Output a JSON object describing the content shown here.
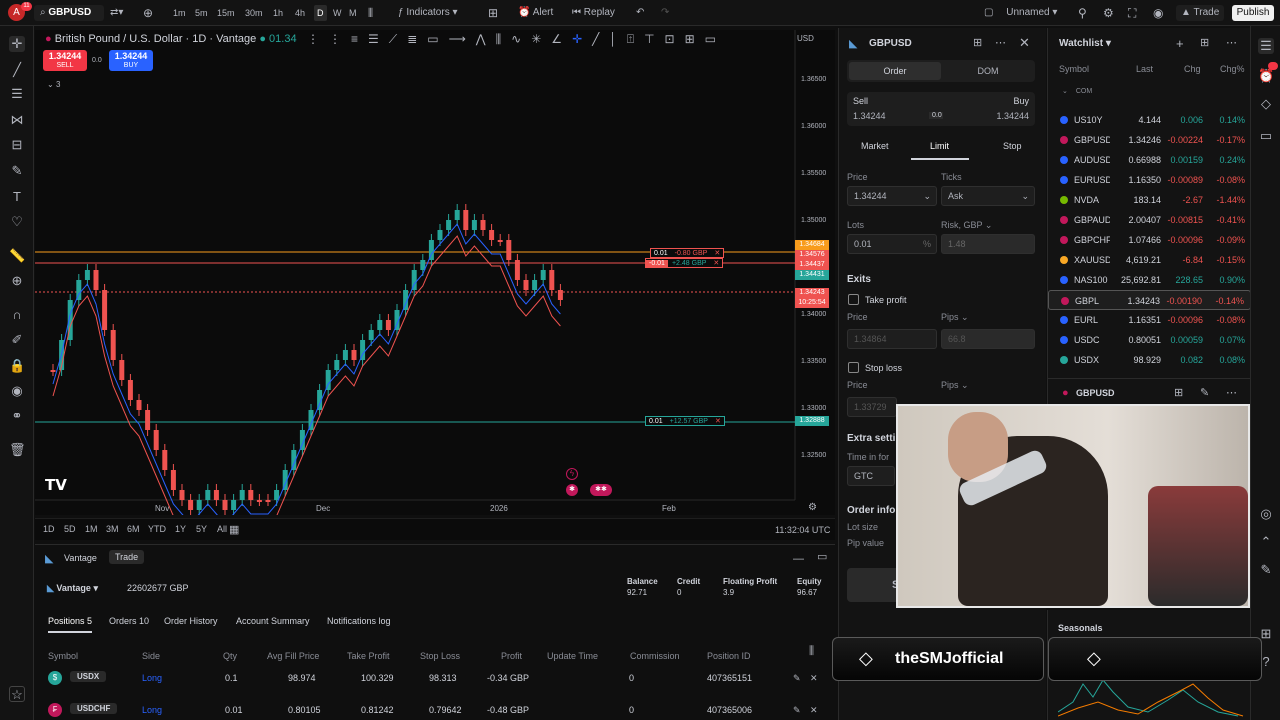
{
  "topbar": {
    "avatar_letter": "A",
    "avatar_badge": "11",
    "symbol": "GBPUSD",
    "timeframes": [
      "1m",
      "5m",
      "15m",
      "30m",
      "1h",
      "4h",
      "D",
      "W",
      "M"
    ],
    "indicators": "Indicators",
    "alert": "Alert",
    "replay": "Replay",
    "layout_name": "Unnamed",
    "trade": "Trade",
    "publish": "Publish"
  },
  "chart": {
    "title": "British Pound / U.S. Dollar · 1D · Vantage",
    "ohlc": "01.34",
    "sell_price": "1.34244",
    "sell_label": "SELL",
    "spread": "0.0",
    "buy_price": "1.34244",
    "buy_label": "BUY",
    "indicator_count": "3",
    "currency": "USD",
    "price_ticks": [
      "1.36500",
      "1.36000",
      "1.35500",
      "1.35000",
      "1.34500",
      "1.34000",
      "1.33500",
      "1.33000",
      "1.32500"
    ],
    "price_labels": [
      {
        "text": "1.34684",
        "color": "#f89c1c"
      },
      {
        "text": "1.34576",
        "color": "#ef5350"
      },
      {
        "text": "1.34437",
        "color": "#ef5350"
      },
      {
        "text": "1.34431",
        "color": "#26a69a"
      },
      {
        "text": "1.34243",
        "color": "#ef5350"
      },
      {
        "text": "10:25:54",
        "color": "#ef5350"
      },
      {
        "text": "1.32888",
        "color": "#26a69a"
      }
    ],
    "time_labels": [
      "Nov",
      "Dec",
      "2026",
      "Feb"
    ],
    "order_lines": [
      {
        "qty": "0.01",
        "pl": "-0.80 GBP"
      },
      {
        "qty": "-0.01",
        "pl": "+2.48 GBP"
      },
      {
        "qty": "0.01",
        "pl": "+12.57 GBP"
      }
    ]
  },
  "timeframe_bar": {
    "ranges": [
      "1D",
      "5D",
      "1M",
      "3M",
      "6M",
      "YTD",
      "1Y",
      "5Y",
      "All"
    ],
    "clock": "11:32:04 UTC"
  },
  "bottom": {
    "broker_tab": "Vantage",
    "trade_tab": "Trade",
    "account_name": "Vantage",
    "account_id": "22602677 GBP",
    "summary": [
      {
        "label": "Balance",
        "value": "92.71"
      },
      {
        "label": "Credit",
        "value": "0"
      },
      {
        "label": "Floating Profit",
        "value": "3.9"
      },
      {
        "label": "Equity",
        "value": "96.67"
      }
    ],
    "tabs": [
      "Positions 5",
      "Orders 10",
      "Order History",
      "Account Summary",
      "Notifications log"
    ],
    "columns": [
      "Symbol",
      "Side",
      "Qty",
      "Avg Fill Price",
      "Take Profit",
      "Stop Loss",
      "Profit",
      "Update Time",
      "Commission",
      "Position ID"
    ],
    "rows": [
      {
        "icon": "$",
        "symbol": "USDX",
        "side": "Long",
        "qty": "0.1",
        "avg": "98.974",
        "tp": "100.329",
        "sl": "98.313",
        "profit": "-0.34 GBP",
        "commission": "0",
        "id": "407365151"
      },
      {
        "icon": "₣",
        "symbol": "USDCHF",
        "side": "Long",
        "qty": "0.01",
        "avg": "0.80105",
        "tp": "0.81242",
        "sl": "0.79642",
        "profit": "-0.48 GBP",
        "commission": "0",
        "id": "407365006"
      }
    ]
  },
  "order_panel": {
    "symbol": "GBPUSD",
    "tab_order": "Order",
    "tab_dom": "DOM",
    "sell_label": "Sell",
    "sell_price": "1.34244",
    "spread": "0.0",
    "buy_label": "Buy",
    "buy_price": "1.34244",
    "types": [
      "Market",
      "Limit",
      "Stop"
    ],
    "price_label": "Price",
    "price_value": "1.34244",
    "ticks_label": "Ticks",
    "ticks_value": "Ask",
    "lots_label": "Lots",
    "lots_value": "0.01",
    "lots_unit": "%",
    "risk_label": "Risk, GBP",
    "risk_value": "1.48",
    "exits": "Exits",
    "take_profit": "Take profit",
    "tp_price_label": "Price",
    "tp_price": "1.34864",
    "tp_pips_label": "Pips",
    "tp_pips": "66.8",
    "stop_loss": "Stop loss",
    "sl_price_label": "Price",
    "sl_price": "1.33729",
    "sl_pips_label": "Pips",
    "extra": "Extra setti",
    "time_in_force": "Time in for",
    "tif_value": "GTC",
    "order_info": "Order info",
    "lot_size": "Lot size",
    "pip_value": "Pip value",
    "submit": "St"
  },
  "watchlist": {
    "title": "Watchlist",
    "col_symbol": "Symbol",
    "col_last": "Last",
    "col_chg": "Chg",
    "col_chgp": "Chg%",
    "section": "COM",
    "rows": [
      {
        "sym": "US10Y",
        "last": "4.144",
        "chg": "0.006",
        "chgp": "0.14%",
        "dir": "pos",
        "color": "#2962ff"
      },
      {
        "sym": "GBPUSD",
        "last": "1.34246",
        "chg": "-0.00224",
        "chgp": "-0.17%",
        "dir": "neg",
        "color": "#c2185b"
      },
      {
        "sym": "AUDUSD",
        "last": "0.66988",
        "chg": "0.00159",
        "chgp": "0.24%",
        "dir": "pos",
        "color": "#2962ff"
      },
      {
        "sym": "EURUSD",
        "last": "1.16350",
        "chg": "-0.00089",
        "chgp": "-0.08%",
        "dir": "neg",
        "color": "#2962ff"
      },
      {
        "sym": "NVDA",
        "last": "183.14",
        "chg": "-2.67",
        "chgp": "-1.44%",
        "dir": "neg",
        "color": "#76b900"
      },
      {
        "sym": "GBPAUD",
        "last": "2.00407",
        "chg": "-0.00815",
        "chgp": "-0.41%",
        "dir": "neg",
        "color": "#c2185b"
      },
      {
        "sym": "GBPCHF",
        "last": "1.07466",
        "chg": "-0.00096",
        "chgp": "-0.09%",
        "dir": "neg",
        "color": "#c2185b"
      },
      {
        "sym": "XAUUSD",
        "last": "4,619.21",
        "chg": "-6.84",
        "chgp": "-0.15%",
        "dir": "neg",
        "color": "#f9a825"
      },
      {
        "sym": "NAS100",
        "last": "25,692.81",
        "chg": "228.65",
        "chgp": "0.90%",
        "dir": "pos",
        "color": "#2962ff"
      },
      {
        "sym": "GBPL",
        "last": "1.34243",
        "chg": "-0.00190",
        "chgp": "-0.14%",
        "dir": "neg",
        "color": "#c2185b"
      },
      {
        "sym": "EURL",
        "last": "1.16351",
        "chg": "-0.00096",
        "chgp": "-0.08%",
        "dir": "neg",
        "color": "#2962ff"
      },
      {
        "sym": "USDC",
        "last": "0.80051",
        "chg": "0.00059",
        "chgp": "0.07%",
        "dir": "pos",
        "color": "#2962ff"
      },
      {
        "sym": "USDX",
        "last": "98.929",
        "chg": "0.082",
        "chgp": "0.08%",
        "dir": "pos",
        "color": "#26a69a"
      }
    ],
    "detail_symbol": "GBPUSD",
    "seasonals": "Seasonals"
  },
  "stream": {
    "channel": "theSMJofficial"
  }
}
